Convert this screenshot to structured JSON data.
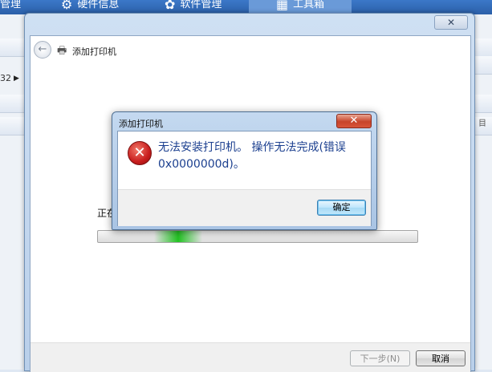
{
  "background_app": {
    "tabs": [
      {
        "label": "管理",
        "icon": "device-icon"
      },
      {
        "label": "硬件信息",
        "icon": "gear-icon"
      },
      {
        "label": "软件管理",
        "icon": "apps-icon"
      },
      {
        "label": "工具箱",
        "icon": "toolbox-icon"
      }
    ],
    "left_fragment": "32",
    "right_fragment": "目"
  },
  "wizard": {
    "title": "添加打印机",
    "close_label": "✕",
    "back_label": "←",
    "status_text": "正在",
    "progress_label": "indeterminate",
    "next_label": "下一步(N)",
    "cancel_label": "取消"
  },
  "dialog": {
    "title": "添加打印机",
    "close_label": "✕",
    "icon": "error-icon",
    "message_line1": "无法安装打印机。 操作无法完成(错误",
    "message_line2": "0x0000000d)。",
    "ok_label": "确定"
  },
  "colors": {
    "error_text": "#1b3f8f",
    "error_icon": "#c81d1d",
    "progress": "#22c322",
    "close_button": "#c7442a"
  }
}
